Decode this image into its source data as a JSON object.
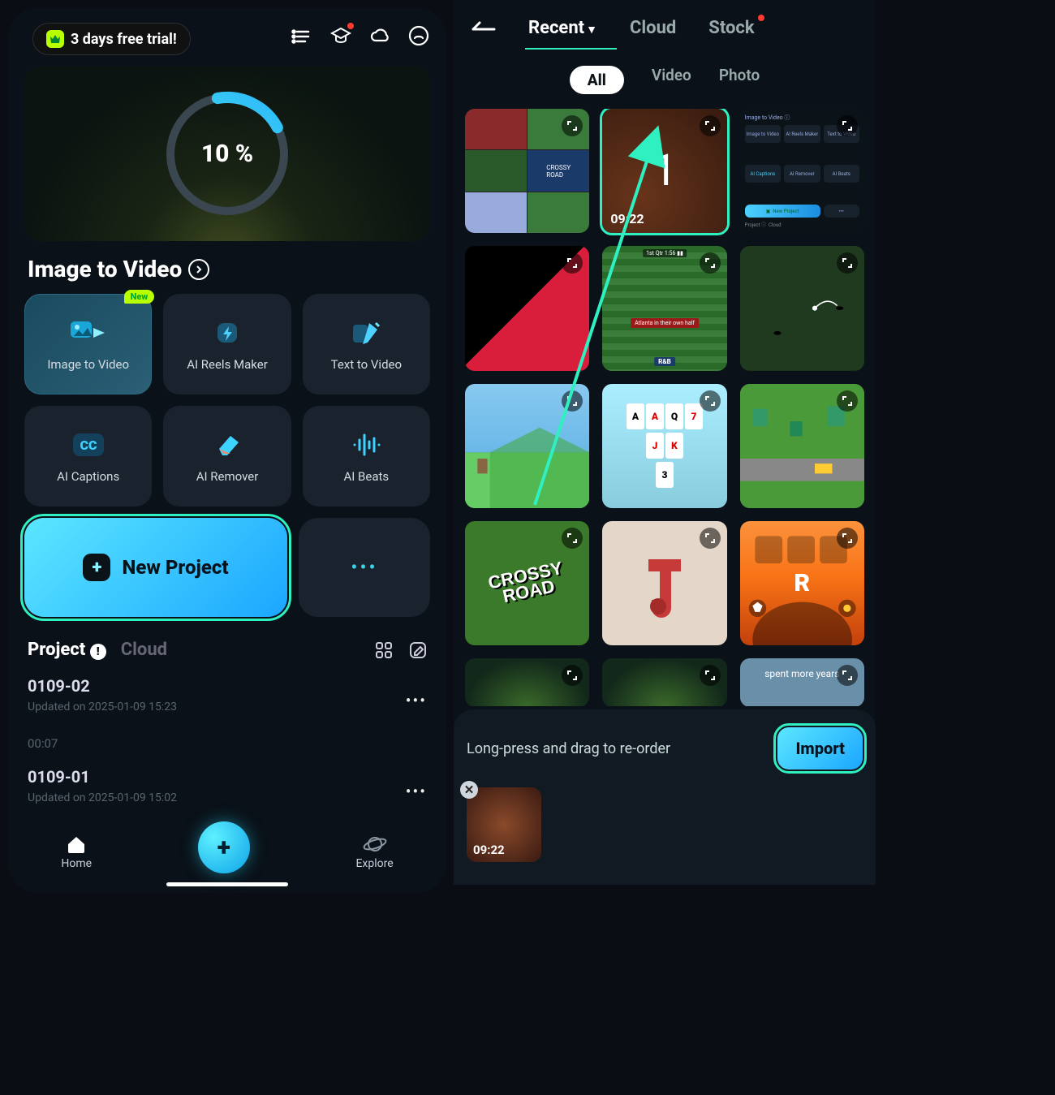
{
  "left": {
    "trial_text": "3 days free trial!",
    "progress_pct": "10 %",
    "section_title": "Image to Video",
    "features": [
      {
        "label": "Image to Video",
        "badge": "New"
      },
      {
        "label": "AI Reels Maker"
      },
      {
        "label": "Text  to Video"
      },
      {
        "label": "AI Captions"
      },
      {
        "label": "AI Remover"
      },
      {
        "label": "AI Beats"
      }
    ],
    "new_project_label": "New Project",
    "tabs": {
      "project": "Project",
      "cloud": "Cloud"
    },
    "projects": [
      {
        "name": "0109-02",
        "meta": "Updated on 2025-01-09 15:23",
        "duration": "00:07"
      },
      {
        "name": "0109-01",
        "meta": "Updated on 2025-01-09 15:02"
      }
    ],
    "nav": {
      "home": "Home",
      "explore": "Explore"
    }
  },
  "right": {
    "tabs": {
      "recent": "Recent",
      "cloud": "Cloud",
      "stock": "Stock"
    },
    "filters": {
      "all": "All",
      "video": "Video",
      "photo": "Photo"
    },
    "selected_index": "1",
    "selected_duration": "09:22",
    "card_thumb": {
      "header": "Image to Video ⓘ",
      "items": [
        "Image to Video",
        "AI Reels Maker",
        "Text  to Video",
        "AI Captions",
        "AI Remover",
        "AI Beats"
      ],
      "btn": "New Project",
      "footer_left": "Project ⓘ",
      "footer_right": "Cloud"
    },
    "football": {
      "score": "1st Qtr  1:56  ▮▮",
      "banner": "Atlanta in their own half",
      "team": "R&B"
    },
    "solitaire_cards": [
      "A",
      "A",
      "Q",
      "7",
      "J",
      "K",
      "3"
    ],
    "crossy_logo_1": "CROSSY",
    "crossy_logo_2": "ROAD",
    "letter_r": "R",
    "grey_caption": "spent more years",
    "reorder_hint": "Long-press and drag to re-order",
    "import_label": "Import",
    "sel_thumb_duration": "09:22"
  }
}
